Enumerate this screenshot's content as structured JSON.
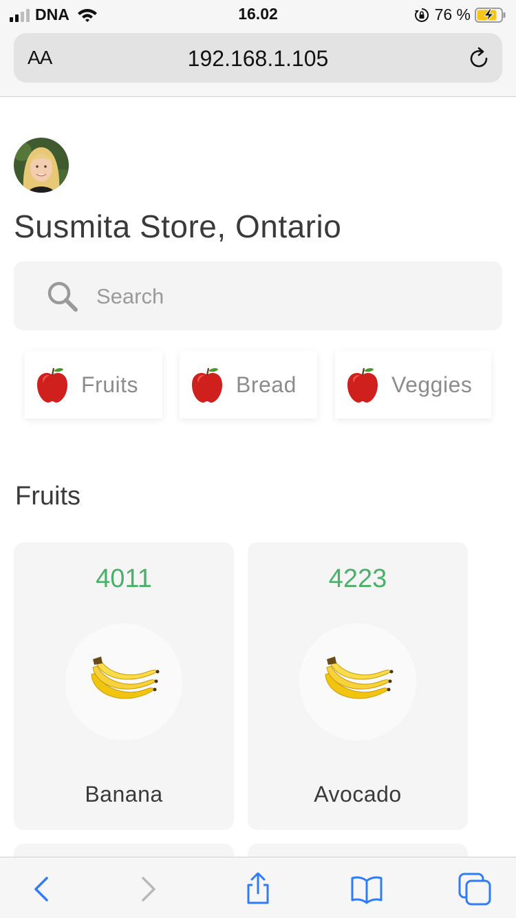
{
  "status_bar": {
    "carrier": "DNA",
    "time": "16.02",
    "battery_percent": "76 %",
    "icons": [
      "cellular-signal-icon",
      "wifi-icon",
      "orientation-lock-icon",
      "battery-charging-icon"
    ]
  },
  "browser": {
    "text_size_label": "AA",
    "url": "192.168.1.105",
    "icons": [
      "reload-icon",
      "back-icon",
      "forward-icon",
      "share-icon",
      "bookmarks-icon",
      "tabs-icon"
    ]
  },
  "store": {
    "title": "Susmita Store, Ontario",
    "search_placeholder": "Search"
  },
  "categories": [
    {
      "label": "Fruits",
      "icon": "apple-icon"
    },
    {
      "label": "Bread",
      "icon": "apple-icon"
    },
    {
      "label": "Veggies",
      "icon": "apple-icon"
    }
  ],
  "section": {
    "title": "Fruits"
  },
  "products": [
    {
      "code": "4011",
      "name": "Banana",
      "icon": "banana-icon"
    },
    {
      "code": "4223",
      "name": "Avocado",
      "icon": "banana-icon"
    }
  ],
  "colors": {
    "accent_green": "#4caf6a",
    "ios_blue": "#2f7cf6",
    "card_bg": "#f5f5f5"
  }
}
